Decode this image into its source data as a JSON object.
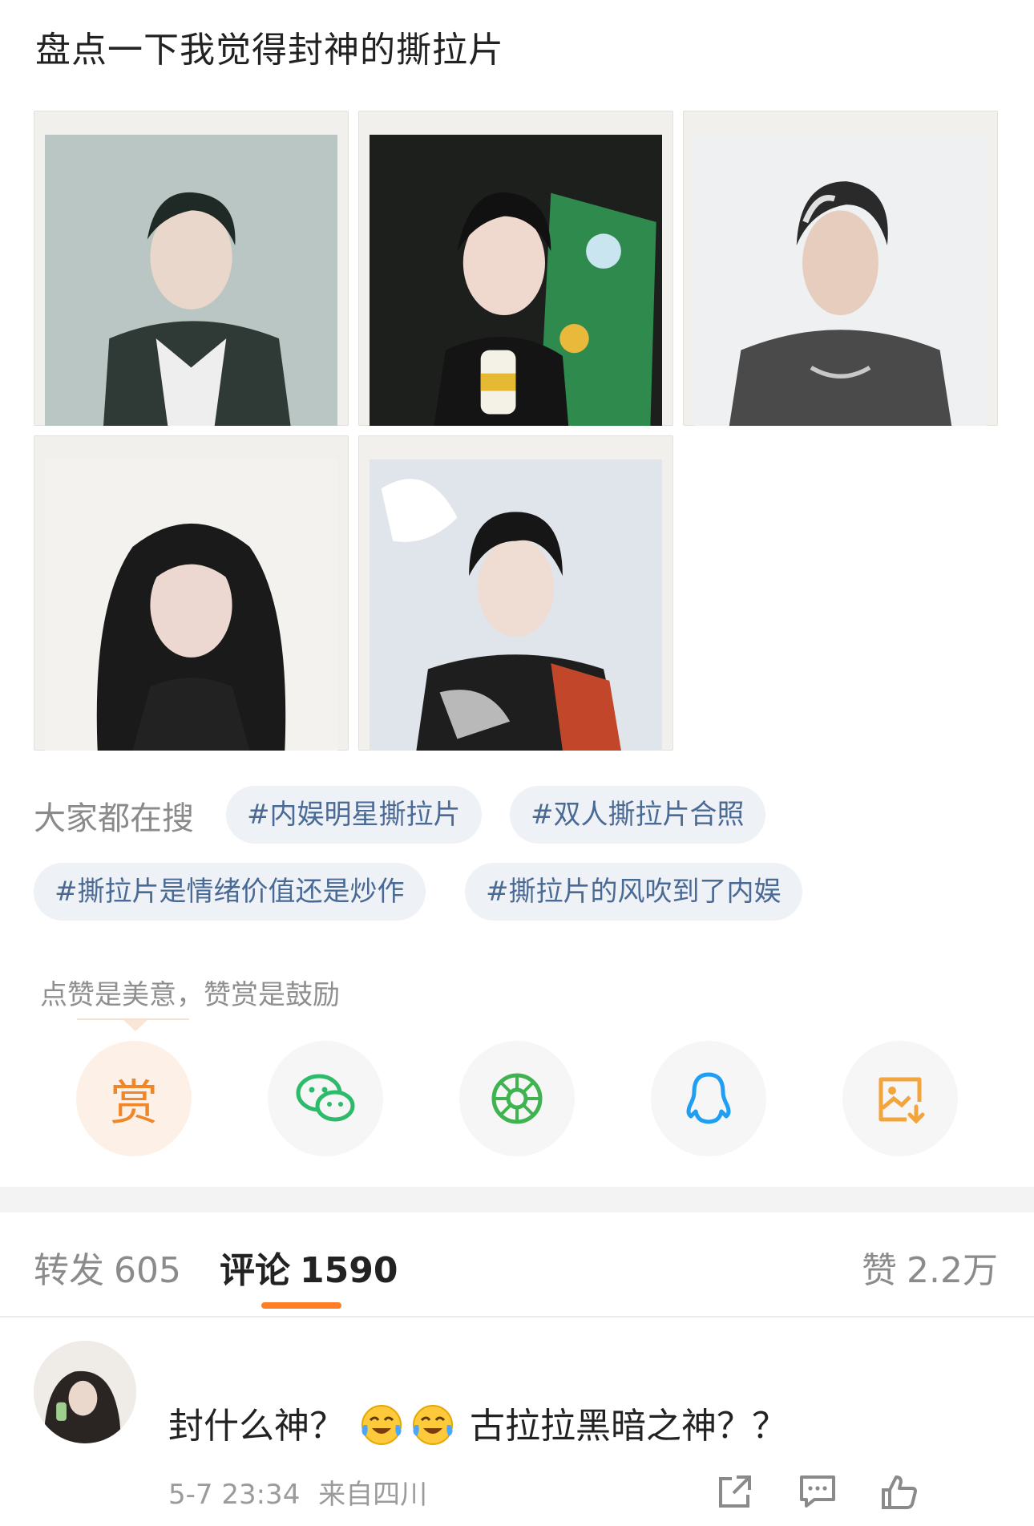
{
  "post": {
    "title": "盘点一下我觉得封神的撕拉片",
    "photos": [
      {
        "label": ""
      },
      {
        "label": ""
      },
      {
        "label": ""
      },
      {
        "label": ""
      },
      {
        "label": ""
      }
    ]
  },
  "search": {
    "label": "大家都在搜",
    "tags": [
      "#内娱明星撕拉片",
      "#双人撕拉片合照",
      "#撕拉片是情绪价值还是炒作",
      "#撕拉片的风吹到了内娱"
    ]
  },
  "reward": {
    "note": "点赞是美意，赞赏是鼓励",
    "button_char": "赏"
  },
  "share_icons": [
    "reward-icon",
    "wechat-icon",
    "moments-icon",
    "qq-icon",
    "save-image-icon"
  ],
  "stats": {
    "repost_label": "转发",
    "repost_count": "605",
    "comment_label": "评论",
    "comment_count": "1590",
    "like_label": "赞",
    "like_count": "2.2万"
  },
  "comment": {
    "text_before": "封什么神？",
    "text_after": "古拉拉黑暗之神？？",
    "time": "5-7 23:34",
    "location": "来自四川",
    "likes": ""
  },
  "colors": {
    "accent": "#ff7d24",
    "tag_text": "#4a6a96",
    "tag_bg": "#eef1f5"
  }
}
